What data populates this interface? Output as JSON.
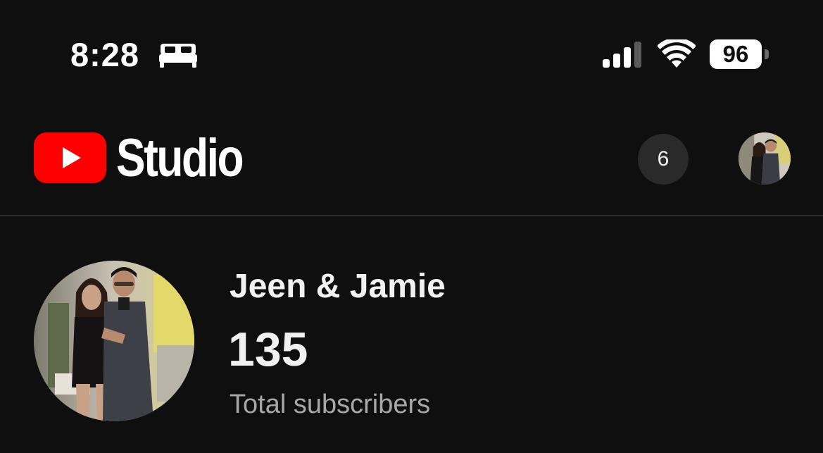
{
  "status_bar": {
    "time": "8:28",
    "focus_icon": "bed-icon",
    "signal_icon": "cellular-signal-icon",
    "wifi_icon": "wifi-icon",
    "battery_level": "96"
  },
  "header": {
    "logo_icon": "youtube-play-icon",
    "brand_name": "Studio",
    "notification_count": "6",
    "account_avatar": "profile-photo"
  },
  "channel": {
    "name": "Jeen & Jamie",
    "subscriber_count": "135",
    "subscriber_label": "Total subscribers",
    "avatar": "channel-profile-photo"
  },
  "colors": {
    "background": "#0f0f0f",
    "youtube_red": "#ff0000",
    "primary_text": "#f1f1f1",
    "secondary_text": "#a8a8a8",
    "badge_background": "#2a2a2a"
  }
}
